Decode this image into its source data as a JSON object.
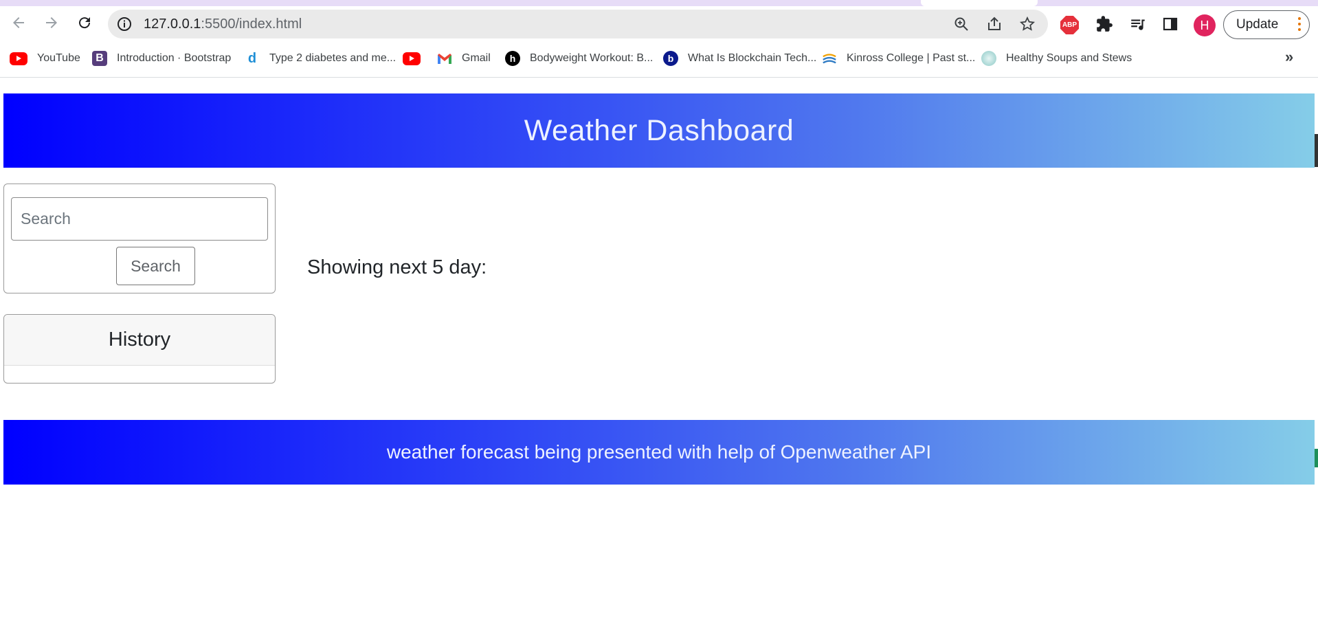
{
  "browser": {
    "url_host": "127.0.0.1",
    "url_path": ":5500/index.html",
    "profile_initial": "H",
    "update_label": "Update",
    "extension_badge": "ABP",
    "bookmarks": [
      {
        "label": "YouTube",
        "icon": "youtube-icon",
        "color": "#ff0000"
      },
      {
        "label": "Introduction · Bootstrap",
        "icon": "bootstrap-icon",
        "color": "#563d7c"
      },
      {
        "label": "Type 2 diabetes and me...",
        "icon": "diabetes-icon",
        "color": "#1f8fd6"
      },
      {
        "label": "",
        "icon": "youtube-icon",
        "color": "#ff0000"
      },
      {
        "label": "Gmail",
        "icon": "gmail-icon",
        "color": "#ea4335"
      },
      {
        "label": "Bodyweight Workout: B...",
        "icon": "workout-icon",
        "color": "#000000"
      },
      {
        "label": "What Is Blockchain Tech...",
        "icon": "blockchain-icon",
        "color": "#0b1a8c"
      },
      {
        "label": "Kinross College | Past st...",
        "icon": "college-icon",
        "color": "#2f7bc4"
      },
      {
        "label": "Healthy Soups and Stews",
        "icon": "soup-icon",
        "color": "#8cc9c6"
      }
    ],
    "more_label": "»"
  },
  "page": {
    "title": "Weather Dashboard",
    "search": {
      "placeholder": "Search",
      "value": "",
      "button_label": "Search"
    },
    "history": {
      "title": "History",
      "items": []
    },
    "forecast_label": "Showing next 5 day:",
    "footer": "weather forecast being presented with help of Openweather API"
  },
  "colors": {
    "gradient_start": "#0000ff",
    "gradient_end": "#85cde8",
    "profile": "#e0245e"
  }
}
